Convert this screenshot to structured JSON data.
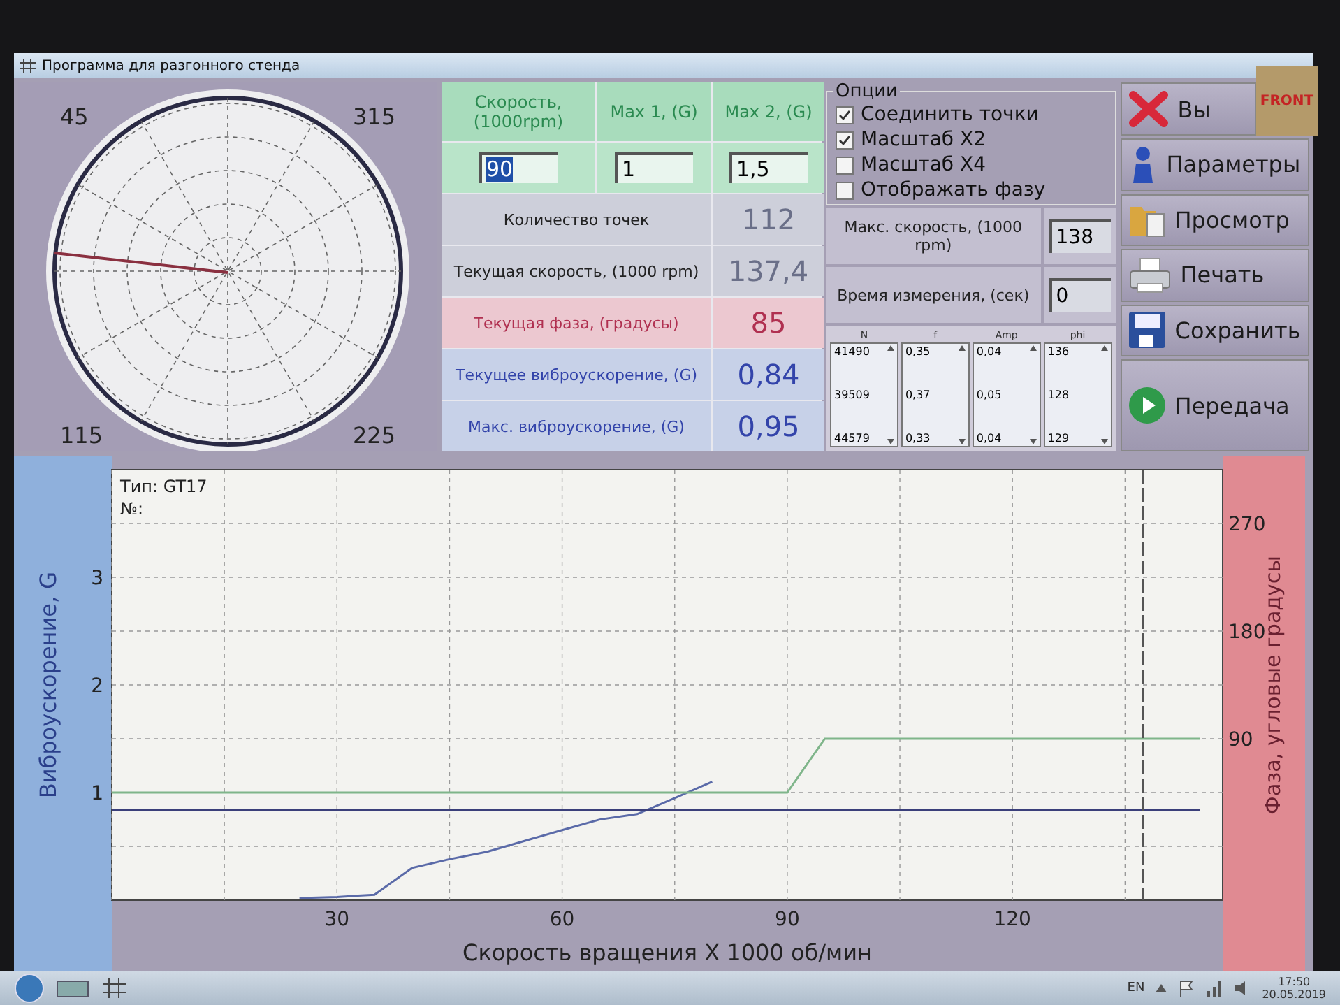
{
  "window": {
    "title": "Программа для разгонного стенда"
  },
  "polar": {
    "labels": [
      "45",
      "315",
      "115",
      "225"
    ]
  },
  "settings": {
    "headers": [
      "Скорость, (1000rpm)",
      "Max 1, (G)",
      "Max 2, (G)"
    ],
    "inputs": [
      {
        "value": "90",
        "selected": true
      },
      {
        "value": "1",
        "selected": false
      },
      {
        "value": "1,5",
        "selected": false
      }
    ]
  },
  "readings": [
    {
      "label": "Количество точек",
      "value": "112",
      "kind": "neutral"
    },
    {
      "label": "Текущая скорость, (1000 rpm)",
      "value": "137,4",
      "kind": "neutral"
    },
    {
      "label": "Текущая фаза, (градусы)",
      "value": "85",
      "kind": "phase"
    },
    {
      "label": "Текущее виброускорение, (G)",
      "value": "0,84",
      "kind": "accel"
    },
    {
      "label": "Макс. виброускорение, (G)",
      "value": "0,95",
      "kind": "accel"
    }
  ],
  "options": {
    "title": "Опции",
    "items": [
      {
        "label": "Соединить точки",
        "checked": true
      },
      {
        "label": "Масштаб X2",
        "checked": true
      },
      {
        "label": "Масштаб X4",
        "checked": false
      },
      {
        "label": "Отображать фазу",
        "checked": false
      }
    ]
  },
  "limits": [
    {
      "label": "Макс. скорость, (1000 rpm)",
      "value": "138"
    },
    {
      "label": "Время измерения, (сек)",
      "value": "0"
    }
  ],
  "results": {
    "columns": [
      {
        "header": "N",
        "values": [
          "41490",
          "39509",
          "44579"
        ]
      },
      {
        "header": "f",
        "values": [
          "0,35",
          "0,37",
          "0,33"
        ]
      },
      {
        "header": "Amp",
        "values": [
          "0,04",
          "0,05",
          "0,04"
        ]
      },
      {
        "header": "phi",
        "values": [
          "136",
          "128",
          "129"
        ]
      }
    ]
  },
  "buttons": [
    {
      "label": "Вы",
      "kind": "exit"
    },
    {
      "label": "Параметры",
      "kind": "info"
    },
    {
      "label": "Просмотр",
      "kind": "folder"
    },
    {
      "label": "Печать",
      "kind": "print"
    },
    {
      "label": "Сохранить",
      "kind": "save"
    },
    {
      "label": "Передача",
      "kind": "send"
    }
  ],
  "sticker": "FRONT",
  "chart": {
    "info": [
      "Тип:  GT17",
      "№:"
    ],
    "phase_axis": {
      "label": "Фаза, угловые градусы",
      "ticks": [
        "270",
        "180",
        "90"
      ]
    },
    "chart_data": {
      "type": "line",
      "xlabel": "Скорость вращения  X 1000 об/мин",
      "ylabel": "Виброускорение, G",
      "x": [
        0,
        5,
        10,
        15,
        20,
        25,
        30,
        35,
        40,
        45,
        50,
        55,
        60,
        65,
        70,
        75,
        80,
        85,
        90,
        95,
        100,
        105,
        110,
        115,
        120,
        125,
        130,
        135,
        140,
        145
      ],
      "grid": true,
      "xlim": [
        0,
        148
      ],
      "ylim": [
        0,
        4
      ],
      "xticks": [
        30,
        60,
        90,
        120
      ],
      "yticks": [
        1,
        2,
        3
      ],
      "series": [
        {
          "color": "#5a6aa8",
          "values": [
            null,
            null,
            null,
            null,
            null,
            0.02,
            0.03,
            0.05,
            0.3,
            0.38,
            0.45,
            0.55,
            0.65,
            0.75,
            0.8,
            0.95,
            1.1,
            null,
            null,
            null,
            null,
            null,
            null,
            null,
            null,
            null,
            null,
            null,
            null,
            null
          ]
        },
        {
          "color": "#7fb58a",
          "values": [
            1,
            1,
            1,
            1,
            1,
            1,
            1,
            1,
            1,
            1,
            1,
            1,
            1,
            1,
            1,
            1,
            1,
            1,
            1,
            1.5,
            1.5,
            1.5,
            1.5,
            1.5,
            1.5,
            1.5,
            1.5,
            1.5,
            1.5,
            1.5
          ]
        },
        {
          "color": "#3a3f7a",
          "values": [
            0.84,
            0.84,
            0.84,
            0.84,
            0.84,
            0.84,
            0.84,
            0.84,
            0.84,
            0.84,
            0.84,
            0.84,
            0.84,
            0.84,
            0.84,
            0.84,
            0.84,
            0.84,
            0.84,
            0.84,
            0.84,
            0.84,
            0.84,
            0.84,
            0.84,
            0.84,
            0.84,
            0.84,
            0.84,
            0.84
          ]
        }
      ],
      "ref_lines": [
        {
          "axis": "x",
          "value": 137.4
        }
      ]
    }
  },
  "taskbar": {
    "language": "EN",
    "time": "17:50",
    "date": "20.05.2019"
  }
}
